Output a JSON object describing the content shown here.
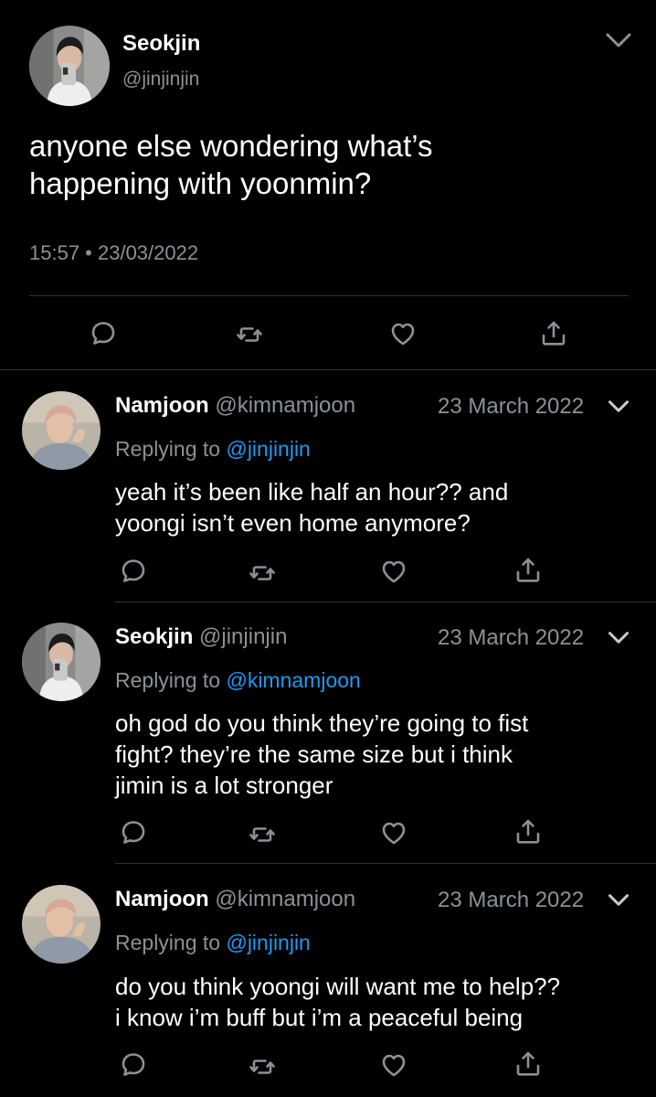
{
  "colors": {
    "background": "#000000",
    "text": "#ffffff",
    "muted": "#8b9197",
    "link": "#1d9bf0",
    "divider": "#2f3336"
  },
  "main_tweet": {
    "name": "Seokjin",
    "handle": "@jinjinjin",
    "text_line1": "anyone else wondering what’s",
    "text_line2": "happening with yoonmin?",
    "timestamp": "15:57 • 23/03/2022",
    "actions": [
      "reply-icon",
      "retweet-icon",
      "like-icon",
      "share-icon"
    ]
  },
  "replies": [
    {
      "name": "Namjoon",
      "handle": "@kimnamjoon",
      "date": "23 March 2022",
      "replying_prefix": "Replying to",
      "replying_to": "@jinjinjin",
      "text_line1": "yeah it’s been like half an hour?? and",
      "text_line2": "yoongi isn’t even home anymore?"
    },
    {
      "name": "Seokjin",
      "handle": "@jinjinjin",
      "date": "23 March 2022",
      "replying_prefix": "Replying to",
      "replying_to": "@kimnamjoon",
      "text_line1": "oh god do you think they’re going to fist",
      "text_line2": "fight? they’re the same size but i think",
      "text_line3": "jimin is a lot stronger"
    },
    {
      "name": "Namjoon",
      "handle": "@kimnamjoon",
      "date": "23 March 2022",
      "replying_prefix": "Replying to",
      "replying_to": "@jinjinjin",
      "text_line1": "do you think yoongi will want me to help??",
      "text_line2": "i know i’m buff but i’m a peaceful being"
    }
  ]
}
